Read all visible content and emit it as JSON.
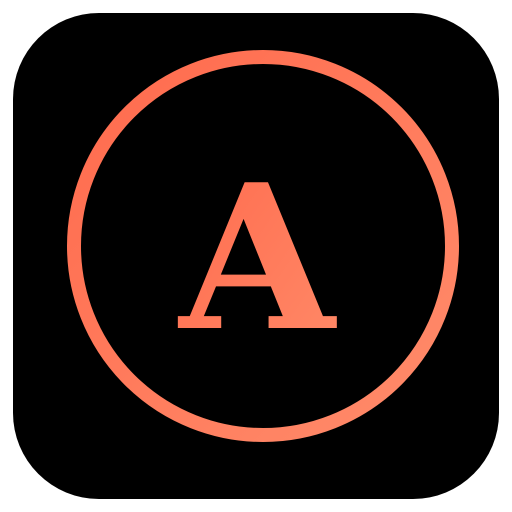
{
  "icon": {
    "letter": "A",
    "background_color": "#000000",
    "ring_gradient": [
      "#ff6a4d",
      "#ff8c6b"
    ],
    "letter_gradient": [
      "#ff6a4d",
      "#ff8a68"
    ],
    "shape": "rounded-square",
    "name": "letter-a-icon"
  }
}
